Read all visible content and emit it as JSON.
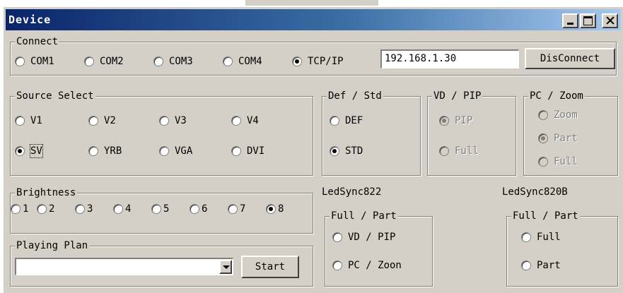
{
  "window": {
    "title": "Device"
  },
  "connect": {
    "legend": "Connect",
    "options": [
      "COM1",
      "COM2",
      "COM3",
      "COM4",
      "TCP/IP"
    ],
    "selected": "TCP/IP",
    "ip": "192.168.1.30",
    "disconnect_label": "DisConnect"
  },
  "source": {
    "legend": "Source Select",
    "options": [
      "V1",
      "V2",
      "V3",
      "V4",
      "SV",
      "YRB",
      "VGA",
      "DVI"
    ],
    "selected": "SV"
  },
  "defstd": {
    "legend": "Def / Std",
    "options": [
      "DEF",
      "STD"
    ],
    "selected": "STD"
  },
  "vdpip": {
    "legend": "VD / PIP",
    "options": [
      "PIP",
      "Full"
    ],
    "selected": "PIP"
  },
  "pczoom": {
    "legend": "PC / Zoom",
    "options": [
      "Zoom",
      "Part",
      "Full"
    ],
    "selected": "Part"
  },
  "brightness": {
    "legend": "Brightness",
    "options": [
      "1",
      "2",
      "3",
      "4",
      "5",
      "6",
      "7",
      "8"
    ],
    "selected": "8"
  },
  "playing": {
    "legend": "Playing Plan",
    "value": "",
    "start_label": "Start"
  },
  "led822": {
    "label": "LedSync822",
    "legend": "Full / Part",
    "options": [
      "VD / PIP",
      "PC / Zoon"
    ]
  },
  "led820": {
    "label": "LedSync820B",
    "legend": "Full / Part",
    "options": [
      "Full",
      "Part"
    ]
  }
}
